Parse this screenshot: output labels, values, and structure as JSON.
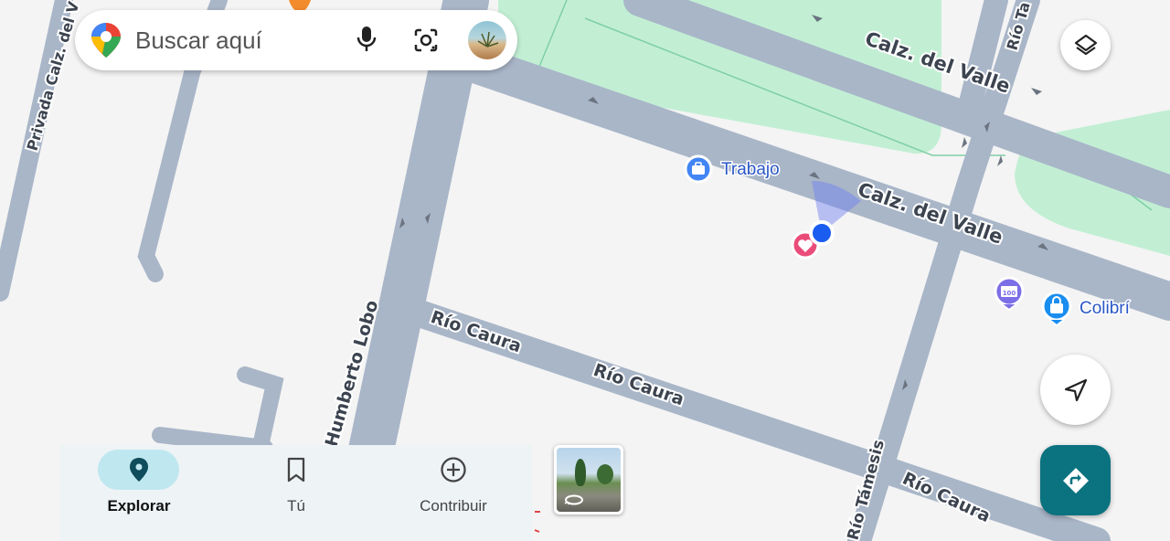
{
  "search": {
    "placeholder": "Buscar aquí",
    "icons": [
      "maps-pin-icon",
      "mic-icon",
      "lens-icon",
      "avatar"
    ]
  },
  "map": {
    "roads": {
      "calz_del_valle_1": "Calz. del Valle",
      "calz_del_valle_2": "Calz. del Valle",
      "humberto_lobo": "Humberto Lobo",
      "rio_caura_1": "Río Caura",
      "rio_caura_2": "Río Caura",
      "rio_caura_3": "Río Caura",
      "rio_tamesis": "Río Támesis",
      "privada": "Privada Calz. del V",
      "rio_top": "Río Ta"
    },
    "pois": {
      "trabajo": "Trabajo",
      "colibri": "Colibrí"
    },
    "colors": {
      "park": "#c2efd4",
      "road": "#a9b6c8",
      "land": "#f4f4f4",
      "location_dot": "#1a5cf0",
      "poi_blue": "#4285f4",
      "favorite": "#ea4c79"
    }
  },
  "controls": {
    "layers_icon": "layers-icon",
    "my_location_icon": "navigation-arrow-icon",
    "directions_icon": "directions-icon"
  },
  "nav": {
    "items": [
      {
        "label": "Explorar",
        "icon": "explore-pin-icon",
        "active": true
      },
      {
        "label": "Tú",
        "icon": "bookmark-icon",
        "active": false
      },
      {
        "label": "Contribuir",
        "icon": "add-circle-icon",
        "active": false
      }
    ]
  },
  "streetview": {
    "icon": "360-rotate-icon"
  }
}
